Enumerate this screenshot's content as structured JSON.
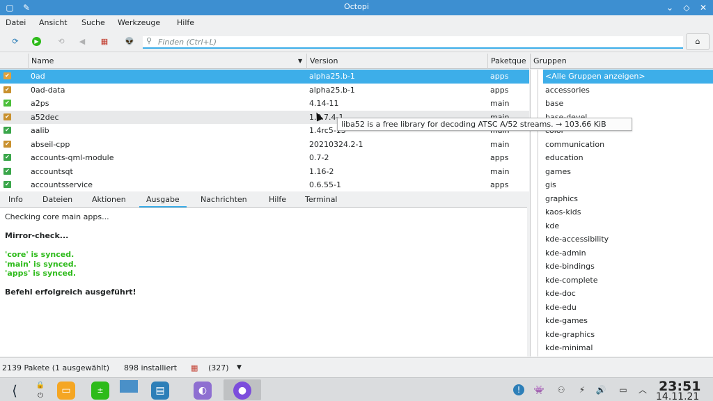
{
  "window": {
    "title": "Octopi",
    "controls": [
      "chevron-down-icon",
      "diamond-icon",
      "close-icon"
    ]
  },
  "menubar": [
    "Datei",
    "Ansicht",
    "Suche",
    "Werkzeuge",
    "Hilfe"
  ],
  "toolbar": {
    "search_placeholder": "Finden  (Ctrl+L)"
  },
  "packages": {
    "headers": [
      "Name",
      "Version",
      "Paketque",
      "Gruppen"
    ],
    "rows": [
      {
        "name": "0ad",
        "version": "alpha25.b-1",
        "repo": "apps",
        "icon_color": "#e2a23b"
      },
      {
        "name": "0ad-data",
        "version": "alpha25.b-1",
        "repo": "apps",
        "icon_color": "#c9912f"
      },
      {
        "name": "a2ps",
        "version": "4.14-11",
        "repo": "main",
        "icon_color": "#4bbf3a"
      },
      {
        "name": "a52dec",
        "version": "1.0.7.4-1",
        "repo": "main",
        "icon_color": "#c9912f"
      },
      {
        "name": "aalib",
        "version": "1.4rc5-13",
        "repo": "main",
        "icon_color": "#3aa64a"
      },
      {
        "name": "abseil-cpp",
        "version": "20210324.2-1",
        "repo": "main",
        "icon_color": "#c9912f"
      },
      {
        "name": "accounts-qml-module",
        "version": "0.7-2",
        "repo": "apps",
        "icon_color": "#3aa64a"
      },
      {
        "name": "accountsqt",
        "version": "1.16-2",
        "repo": "main",
        "icon_color": "#3aa64a"
      },
      {
        "name": "accountsservice",
        "version": "0.6.55-1",
        "repo": "apps",
        "icon_color": "#3aa64a"
      }
    ]
  },
  "groups": [
    "<Alle Gruppen anzeigen>",
    "accessories",
    "base",
    "base-devel",
    "color",
    "communication",
    "education",
    "games",
    "gis",
    "graphics",
    "kaos-kids",
    "kde",
    "kde-accessibility",
    "kde-admin",
    "kde-bindings",
    "kde-complete",
    "kde-doc",
    "kde-edu",
    "kde-games",
    "kde-graphics",
    "kde-minimal"
  ],
  "tabs": [
    "Info",
    "Dateien",
    "Aktionen",
    "Ausgabe",
    "Nachrichten",
    "Hilfe",
    "Terminal"
  ],
  "output": [
    {
      "text": "Checking core main apps...",
      "style": "normal"
    },
    {
      "text": "Mirror-check...",
      "style": "bold"
    },
    {
      "text": "'core' is synced.",
      "style": "green"
    },
    {
      "text": "'main' is synced.",
      "style": "green"
    },
    {
      "text": "'apps' is synced.",
      "style": "green"
    },
    {
      "text": "Befehl erfolgreich ausgeführt!",
      "style": "bold"
    }
  ],
  "tooltip": "liba52 is a free library for decoding ATSC A/52 streams. → 103.66 KiB",
  "status": {
    "packages": "2139 Pakete (1 ausgewählt)",
    "installed": "898 installiert",
    "updates": "(327)"
  },
  "taskbar": {
    "time": "23:51",
    "date": "14.11.21"
  },
  "colors": {
    "accent": "#3daee9",
    "titlebar": "#3d8fd1",
    "success": "#2dbb1a"
  }
}
